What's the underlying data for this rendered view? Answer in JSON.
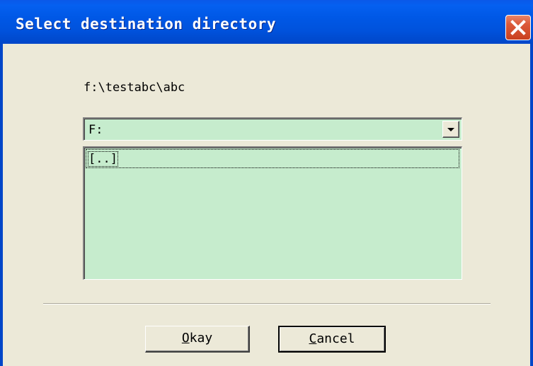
{
  "window": {
    "title": "Select destination directory"
  },
  "dialog": {
    "current_path": "f:\\testabc\\abc",
    "drive": {
      "selected": "F:"
    },
    "directories": [
      {
        "label": "[..]"
      }
    ],
    "buttons": {
      "ok": {
        "mnemonic": "O",
        "rest": "kay"
      },
      "cancel": {
        "mnemonic": "C",
        "rest": "ancel"
      }
    }
  },
  "colors": {
    "title_bar": "#0058e6",
    "close_button": "#dc5a3a",
    "face": "#ece9d8",
    "list_background": "#c6eccd"
  },
  "icons": {
    "close": "close-icon",
    "dropdown": "chevron-down-icon"
  }
}
